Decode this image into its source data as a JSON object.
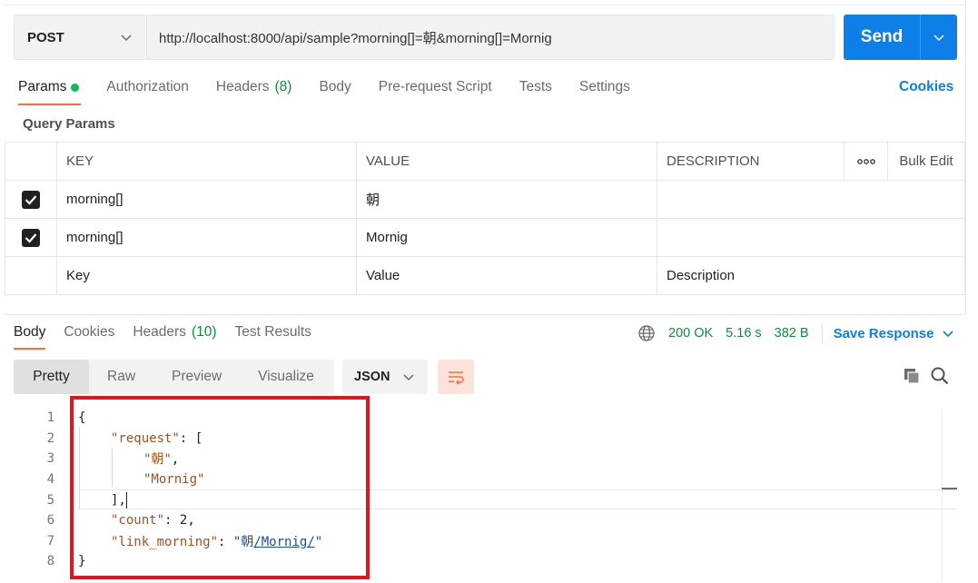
{
  "request": {
    "method": "POST",
    "url": "http://localhost:8000/api/sample?morning[]=朝&morning[]=Mornig",
    "send_label": "Send"
  },
  "request_tabs": {
    "params": "Params",
    "authorization": "Authorization",
    "headers": "Headers",
    "headers_count": "(8)",
    "body": "Body",
    "prerequest": "Pre-request Script",
    "tests": "Tests",
    "settings": "Settings",
    "cookies": "Cookies"
  },
  "query_params": {
    "title": "Query Params",
    "columns": {
      "key": "KEY",
      "value": "VALUE",
      "description": "DESCRIPTION",
      "bulk_edit": "Bulk Edit"
    },
    "rows": [
      {
        "key": "morning[]",
        "value": "朝",
        "description": "",
        "checked": true
      },
      {
        "key": "morning[]",
        "value": "Mornig",
        "description": "",
        "checked": true
      }
    ],
    "placeholders": {
      "key": "Key",
      "value": "Value",
      "description": "Description"
    }
  },
  "response_tabs": {
    "body": "Body",
    "cookies": "Cookies",
    "headers": "Headers",
    "headers_count": "(10)",
    "test_results": "Test Results"
  },
  "response_status": {
    "status": "200 OK",
    "time": "5.16 s",
    "size": "382 B",
    "save_response": "Save Response"
  },
  "view_modes": {
    "pretty": "Pretty",
    "raw": "Raw",
    "preview": "Preview",
    "visualize": "Visualize",
    "format": "JSON"
  },
  "code": {
    "line_numbers": [
      "1",
      "2",
      "3",
      "4",
      "5",
      "6",
      "7",
      "8"
    ],
    "open_brace": "{",
    "request_key": "\"request\"",
    "colon_bracket": ": [",
    "val1": "\"朝\"",
    "val1_comma": ",",
    "val2": "\"Mornig\"",
    "close_bracket": "],",
    "count_key": "\"count\"",
    "count_sep": ": ",
    "count_val": "2",
    "count_comma": ",",
    "link_key": "\"link_morning\"",
    "link_sep": ": ",
    "link_quote_open": "\"朝",
    "link_text": "/Mornig/",
    "link_quote_close": "\"",
    "close_brace": "}"
  },
  "colors": {
    "accent": "#0d7fe6",
    "orange": "#ff6c37",
    "status_green": "#0a8f3c",
    "highlight_red": "#e3141e"
  }
}
